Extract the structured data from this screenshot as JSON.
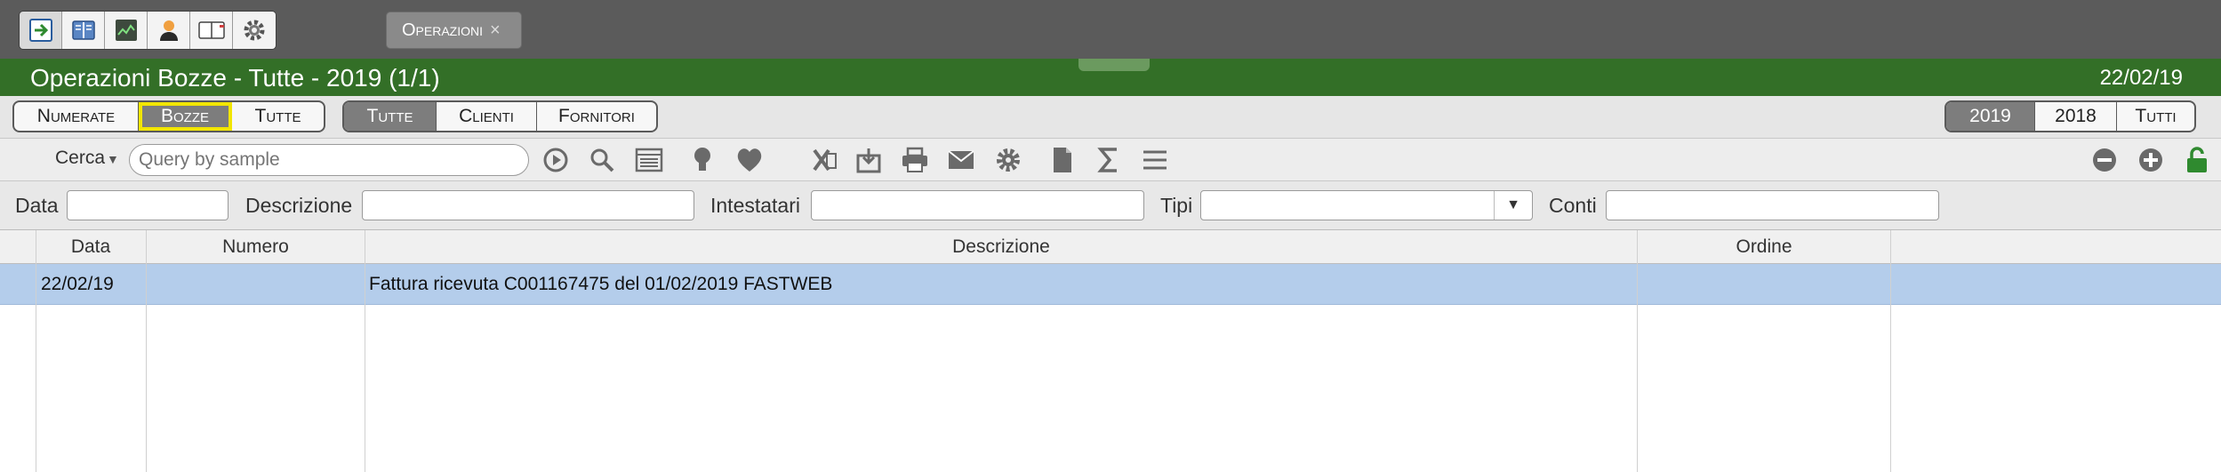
{
  "toolbar_apps": [
    {
      "name": "import-icon"
    },
    {
      "name": "book-icon"
    },
    {
      "name": "monitor-chart-icon"
    },
    {
      "name": "user-icon"
    },
    {
      "name": "ledger-icon"
    },
    {
      "name": "gear-icon"
    }
  ],
  "doc_tab": {
    "label": "Operazioni",
    "close": "×"
  },
  "header": {
    "title": "Operazioni Bozze - Tutte - 2019 (1/1)",
    "date": "22/02/19"
  },
  "segments": {
    "status": [
      "Numerate",
      "Bozze",
      "Tutte"
    ],
    "party": [
      "Tutte",
      "Clienti",
      "Fornitori"
    ],
    "years": [
      "2019",
      "2018",
      "Tutti"
    ]
  },
  "search": {
    "label": "Cerca",
    "placeholder": "Query by sample"
  },
  "filters": {
    "data": "Data",
    "descrizione": "Descrizione",
    "intestatari": "Intestatari",
    "tipi": "Tipi",
    "conti": "Conti"
  },
  "table": {
    "columns": [
      "Data",
      "Numero",
      "Descrizione",
      "Ordine"
    ],
    "rows": [
      {
        "data": "22/02/19",
        "numero": "",
        "descrizione": "Fattura ricevuta C001167475 del 01/02/2019 FASTWEB",
        "ordine": ""
      }
    ]
  },
  "colors": {
    "title_bar": "#336f27",
    "selected_row": "#b4cdeb",
    "highlight": "#f2e600"
  }
}
